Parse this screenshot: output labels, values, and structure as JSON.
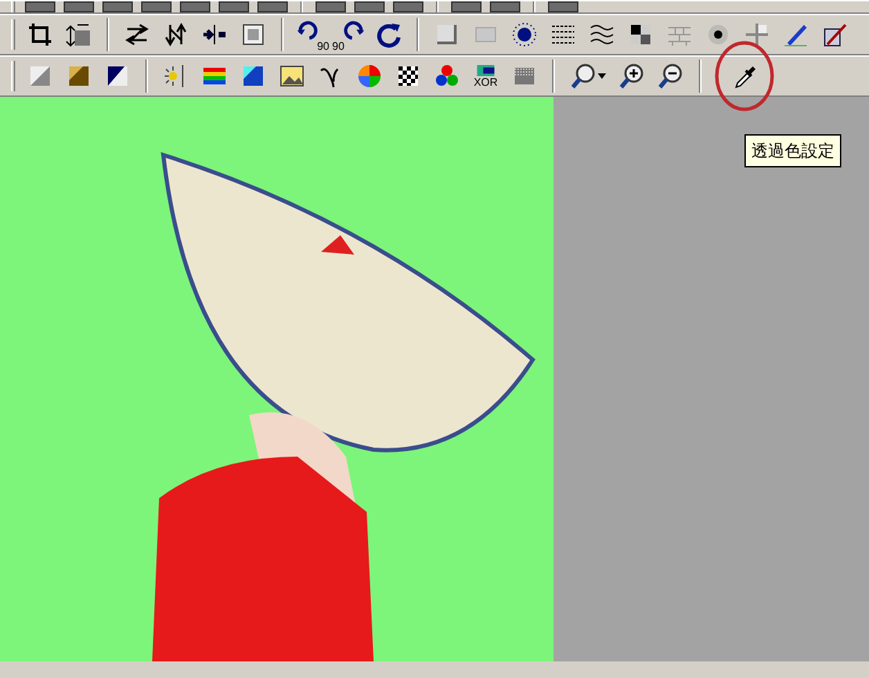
{
  "toolbars": [
    {
      "groups": [
        [
          {
            "kind": "cut"
          },
          {
            "kind": "cut"
          },
          {
            "kind": "cut"
          },
          {
            "kind": "cut"
          },
          {
            "kind": "cut"
          },
          {
            "kind": "cut"
          },
          {
            "kind": "cut"
          }
        ],
        [
          {
            "kind": "cut"
          },
          {
            "kind": "cut"
          },
          {
            "kind": "cut"
          }
        ],
        [
          {
            "kind": "cut"
          },
          {
            "kind": "cut"
          }
        ],
        [
          {
            "kind": "cut"
          }
        ]
      ]
    },
    {
      "groups": [
        [
          {
            "kind": "crop"
          },
          {
            "kind": "resize"
          }
        ],
        [
          {
            "kind": "fliph"
          },
          {
            "kind": "flipv"
          },
          {
            "kind": "split"
          },
          {
            "kind": "frame"
          }
        ],
        [
          {
            "kind": "rotl",
            "label": "90"
          },
          {
            "kind": "rotr",
            "label": "90"
          },
          {
            "kind": "rot"
          }
        ],
        [
          {
            "kind": "bevel"
          },
          {
            "kind": "rect"
          },
          {
            "kind": "burst"
          },
          {
            "kind": "lines"
          },
          {
            "kind": "wave"
          },
          {
            "kind": "mosaic"
          },
          {
            "kind": "brick"
          },
          {
            "kind": "glow"
          },
          {
            "kind": "grid"
          },
          {
            "kind": "pen"
          },
          {
            "kind": "bucket"
          }
        ]
      ]
    },
    {
      "groups": [
        [
          {
            "kind": "gray"
          },
          {
            "kind": "gold"
          },
          {
            "kind": "navy"
          }
        ],
        [
          {
            "kind": "sparkle"
          },
          {
            "kind": "rainbow"
          },
          {
            "kind": "cyan"
          },
          {
            "kind": "picture"
          },
          {
            "kind": "gamma"
          },
          {
            "kind": "wheel"
          },
          {
            "kind": "checker"
          },
          {
            "kind": "rgb"
          },
          {
            "kind": "xor",
            "label": "XOR"
          },
          {
            "kind": "noise"
          }
        ],
        [
          {
            "kind": "zoomdrop"
          },
          {
            "kind": "zoomin"
          },
          {
            "kind": "zoomout"
          }
        ],
        [
          {
            "kind": "dropper"
          }
        ]
      ]
    }
  ],
  "tooltip": {
    "text": "透過色設定"
  }
}
